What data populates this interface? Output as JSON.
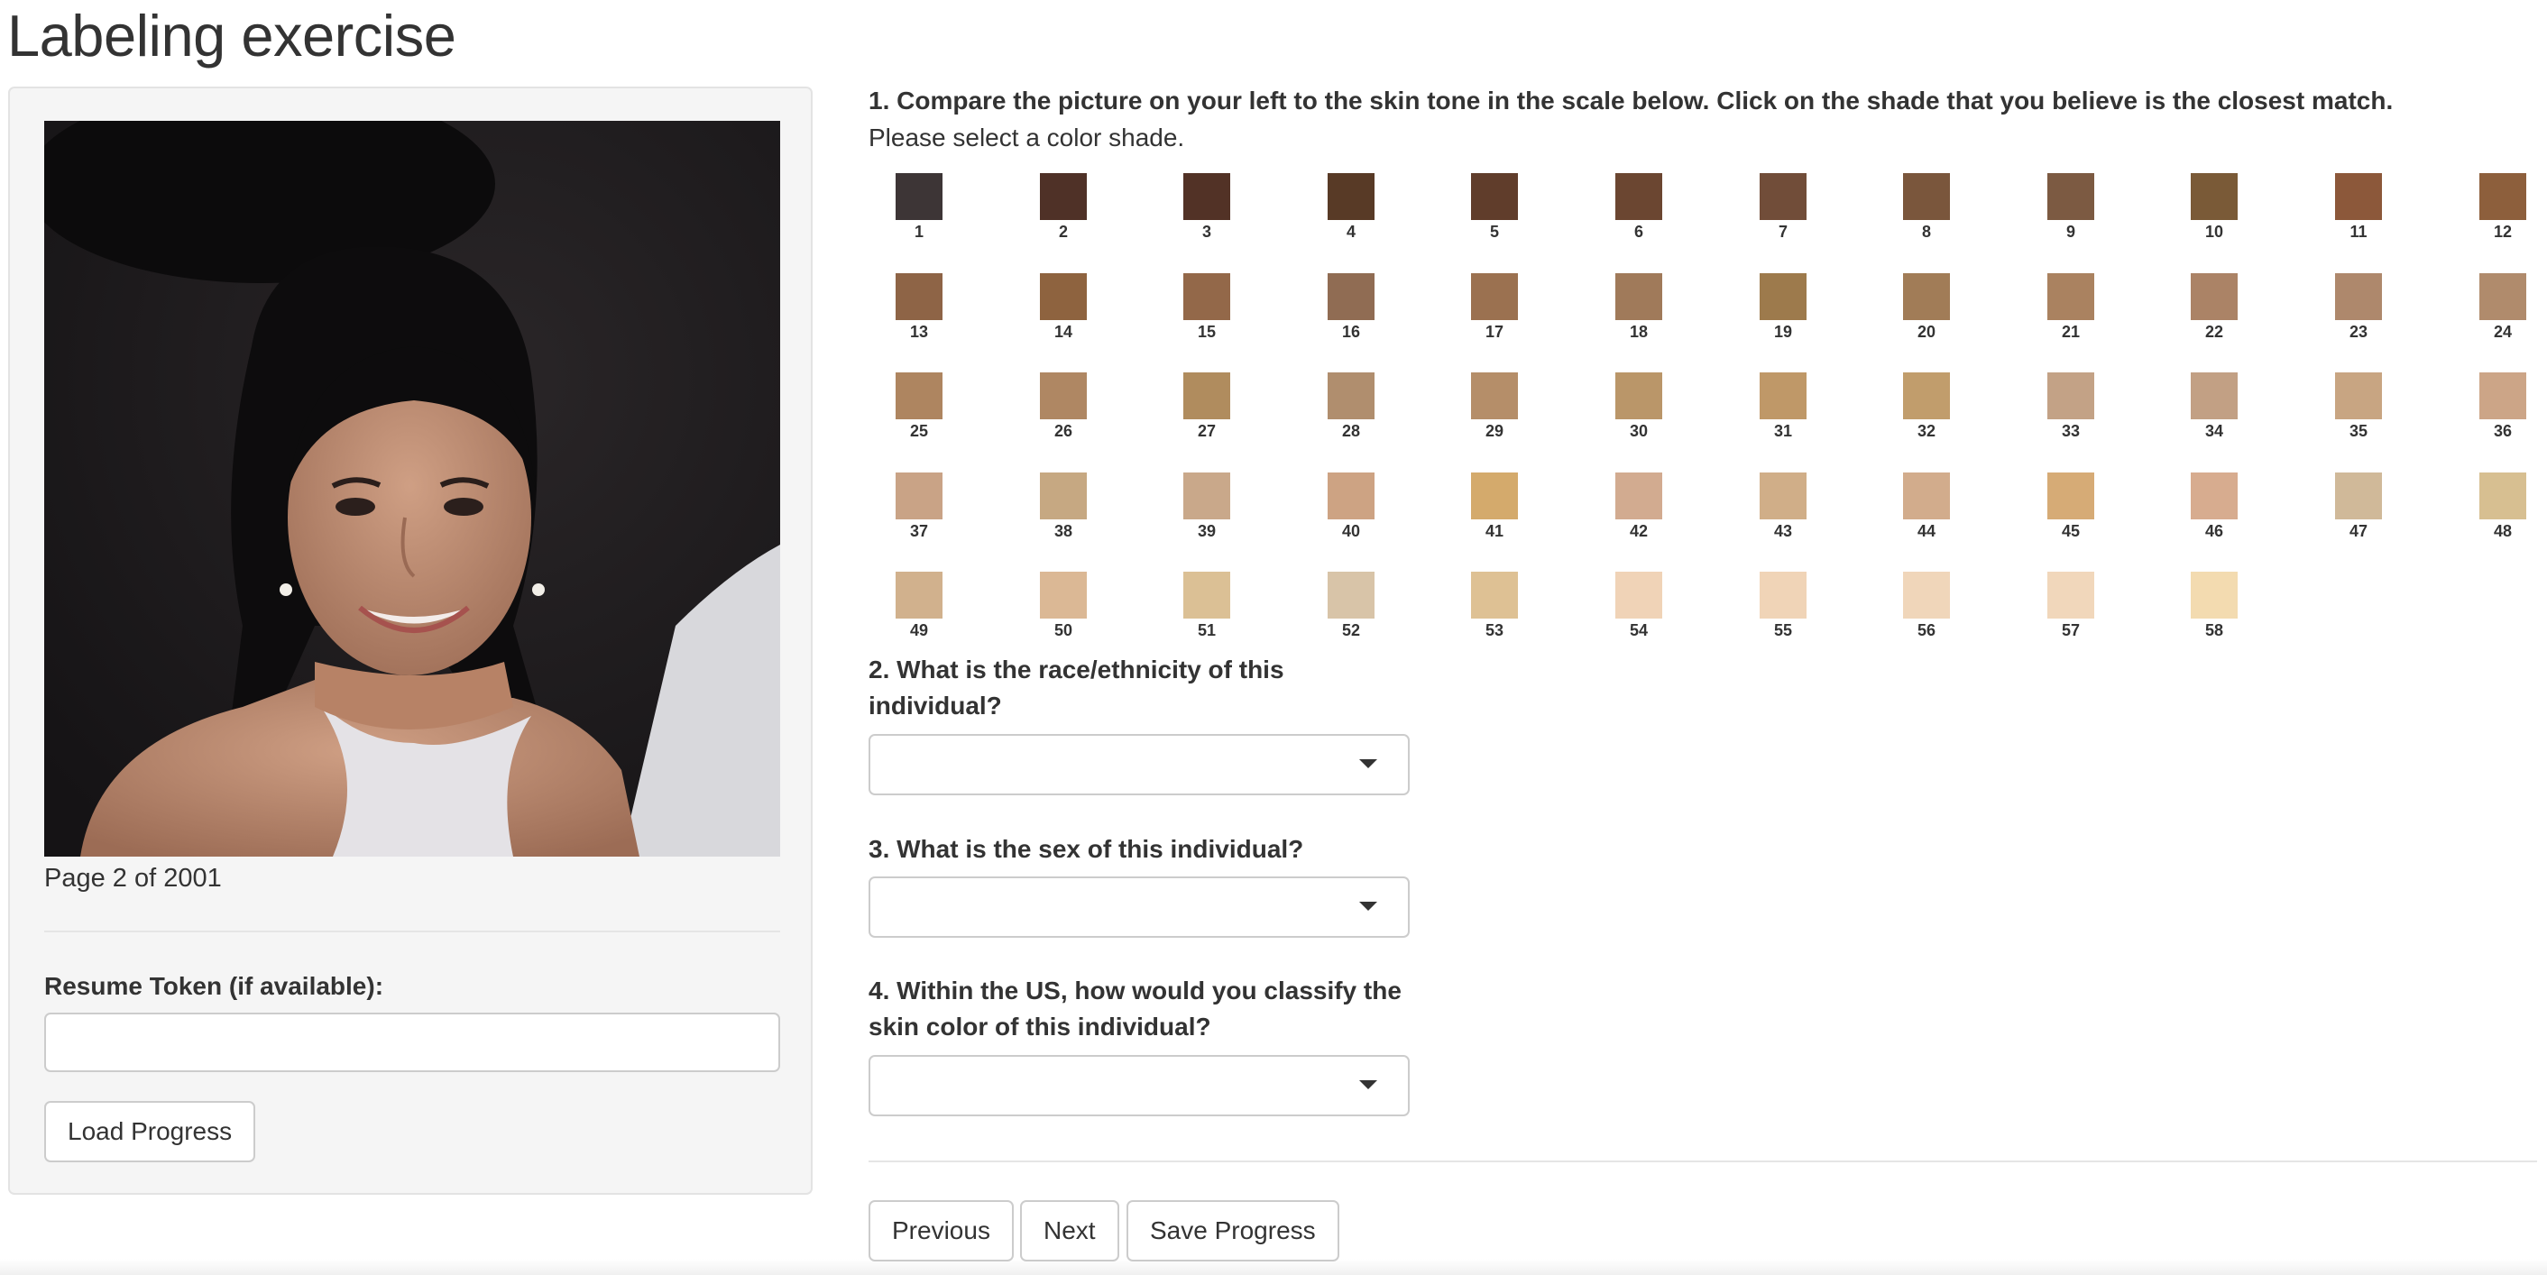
{
  "header": {
    "title": "Labeling exercise"
  },
  "sidebar": {
    "page_counter": "Page 2 of 2001",
    "resume_token_label": "Resume Token (if available):",
    "resume_token_value": "",
    "load_button": "Load Progress"
  },
  "questions": {
    "q1": {
      "label": "1. Compare the picture on your left to the skin tone in the scale below. Click on the shade that you believe is the closest match.",
      "instruction": "Please select a color shade."
    },
    "q2": {
      "label": "2. What is the race/ethnicity of this individual?",
      "selected": ""
    },
    "q3": {
      "label": "3. What is the sex of this individual?",
      "selected": ""
    },
    "q4": {
      "label": "4. Within the US, how would you classify the skin color of this individual?",
      "selected": ""
    }
  },
  "swatches": [
    {
      "n": "1",
      "color": "#3d3536"
    },
    {
      "n": "2",
      "color": "#4f3127"
    },
    {
      "n": "3",
      "color": "#523226"
    },
    {
      "n": "4",
      "color": "#583a26"
    },
    {
      "n": "5",
      "color": "#603d2b"
    },
    {
      "n": "6",
      "color": "#6b4631"
    },
    {
      "n": "7",
      "color": "#714d39"
    },
    {
      "n": "8",
      "color": "#7a563c"
    },
    {
      "n": "9",
      "color": "#7c5a42"
    },
    {
      "n": "10",
      "color": "#7a5a37"
    },
    {
      "n": "11",
      "color": "#8c583a"
    },
    {
      "n": "12",
      "color": "#8d5f3c"
    },
    {
      "n": "13",
      "color": "#8e6446"
    },
    {
      "n": "14",
      "color": "#8e633f"
    },
    {
      "n": "15",
      "color": "#936849"
    },
    {
      "n": "16",
      "color": "#906c53"
    },
    {
      "n": "17",
      "color": "#9b7150"
    },
    {
      "n": "18",
      "color": "#a07a5a"
    },
    {
      "n": "19",
      "color": "#9d7a4c"
    },
    {
      "n": "20",
      "color": "#a17c57"
    },
    {
      "n": "21",
      "color": "#aa8260"
    },
    {
      "n": "22",
      "color": "#ab8366"
    },
    {
      "n": "23",
      "color": "#ae886c"
    },
    {
      "n": "24",
      "color": "#b08b6c"
    },
    {
      "n": "25",
      "color": "#ae8560"
    },
    {
      "n": "26",
      "color": "#af8763"
    },
    {
      "n": "27",
      "color": "#b08c5e"
    },
    {
      "n": "28",
      "color": "#b08e6e"
    },
    {
      "n": "29",
      "color": "#b58e69"
    },
    {
      "n": "30",
      "color": "#ba9669"
    },
    {
      "n": "31",
      "color": "#bf9868"
    },
    {
      "n": "32",
      "color": "#c19d6c"
    },
    {
      "n": "33",
      "color": "#c3a286"
    },
    {
      "n": "34",
      "color": "#c2a084"
    },
    {
      "n": "35",
      "color": "#c8a582"
    },
    {
      "n": "36",
      "color": "#cca587"
    },
    {
      "n": "37",
      "color": "#c9a386"
    },
    {
      "n": "38",
      "color": "#c6a882"
    },
    {
      "n": "39",
      "color": "#c9a88a"
    },
    {
      "n": "40",
      "color": "#cda383"
    },
    {
      "n": "41",
      "color": "#d4aa6c"
    },
    {
      "n": "42",
      "color": "#d2ab90"
    },
    {
      "n": "43",
      "color": "#d0ae88"
    },
    {
      "n": "44",
      "color": "#d2ac8c"
    },
    {
      "n": "45",
      "color": "#d6ab76"
    },
    {
      "n": "46",
      "color": "#d7ac8f"
    },
    {
      "n": "47",
      "color": "#d0b999"
    },
    {
      "n": "48",
      "color": "#d7bf91"
    },
    {
      "n": "49",
      "color": "#d1b18d"
    },
    {
      "n": "50",
      "color": "#dbb895"
    },
    {
      "n": "51",
      "color": "#dbc095"
    },
    {
      "n": "52",
      "color": "#d8c4a8"
    },
    {
      "n": "53",
      "color": "#dec194"
    },
    {
      "n": "54",
      "color": "#f0d3b7"
    },
    {
      "n": "55",
      "color": "#f0d4b7"
    },
    {
      "n": "56",
      "color": "#f0d6ba"
    },
    {
      "n": "57",
      "color": "#f1d7bb"
    },
    {
      "n": "58",
      "color": "#f3dbb0"
    }
  ],
  "nav": {
    "previous": "Previous",
    "next": "Next",
    "save": "Save Progress"
  }
}
